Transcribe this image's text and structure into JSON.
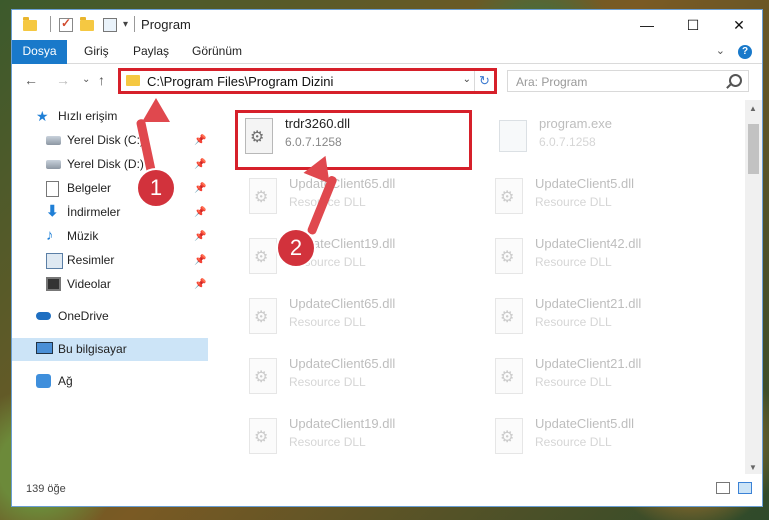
{
  "window": {
    "title": "Program"
  },
  "titlebar": {
    "minimize": "—",
    "maximize": "☐",
    "close": "✕",
    "qa_dropdown": "▾"
  },
  "ribbon": {
    "tabs": [
      "Dosya",
      "Giriş",
      "Paylaş",
      "Görünüm"
    ],
    "expand": "⌄",
    "help": "?"
  },
  "nav": {
    "back": "←",
    "forward": "→",
    "recent": "⌄",
    "up": "↑",
    "address": "C:\\Program Files\\Program Dizini",
    "address_dropdown": "⌄",
    "refresh": "↻",
    "search_placeholder": "Ara: Program"
  },
  "sidebar": {
    "items": [
      {
        "label": "Hızlı erişim",
        "icon": "star-icon"
      },
      {
        "label": "Yerel Disk (C:)",
        "icon": "disk-icon",
        "pinned": true
      },
      {
        "label": "Yerel Disk (D:)",
        "icon": "disk-icon",
        "pinned": true
      },
      {
        "label": "Belgeler",
        "icon": "document-icon",
        "pinned": true
      },
      {
        "label": "İndirmeler",
        "icon": "download-icon",
        "pinned": true
      },
      {
        "label": "Müzik",
        "icon": "music-icon",
        "pinned": true
      },
      {
        "label": "Resimler",
        "icon": "pictures-icon",
        "pinned": true
      },
      {
        "label": "Videolar",
        "icon": "video-icon",
        "pinned": true
      },
      {
        "label": "OneDrive",
        "icon": "cloud-icon"
      },
      {
        "label": "Bu bilgisayar",
        "icon": "computer-icon",
        "selected": true
      },
      {
        "label": "Ağ",
        "icon": "network-icon"
      }
    ],
    "pin_glyph": "📌"
  },
  "files": [
    {
      "name": "trdr3260.dll",
      "sub": "6.0.7.1258",
      "icon": "dll-icon",
      "highlighted": true
    },
    {
      "name": "program.exe",
      "sub": "6.0.7.1258",
      "icon": "exe-icon"
    },
    {
      "name": "UpdateClient65.dll",
      "sub": "Resource DLL",
      "icon": "dll-icon"
    },
    {
      "name": "UpdateClient5.dll",
      "sub": "Resource DLL",
      "icon": "dll-icon"
    },
    {
      "name": "UpdateClient19.dll",
      "sub": "Resource DLL",
      "icon": "dll-icon"
    },
    {
      "name": "UpdateClient42.dll",
      "sub": "Resource DLL",
      "icon": "dll-icon"
    },
    {
      "name": "UpdateClient65.dll",
      "sub": "Resource DLL",
      "icon": "dll-icon"
    },
    {
      "name": "UpdateClient21.dll",
      "sub": "Resource DLL",
      "icon": "dll-icon"
    },
    {
      "name": "UpdateClient65.dll",
      "sub": "Resource DLL",
      "icon": "dll-icon"
    },
    {
      "name": "UpdateClient21.dll",
      "sub": "Resource DLL",
      "icon": "dll-icon"
    },
    {
      "name": "UpdateClient19.dll",
      "sub": "Resource DLL",
      "icon": "dll-icon"
    },
    {
      "name": "UpdateClient5.dll",
      "sub": "Resource DLL",
      "icon": "dll-icon"
    }
  ],
  "status": {
    "item_count": "139 öğe"
  },
  "callouts": {
    "step1": "1",
    "step2": "2"
  },
  "colors": {
    "accent": "#1979ca",
    "highlight": "#d6202a",
    "selected_bg": "#cce4f7"
  }
}
